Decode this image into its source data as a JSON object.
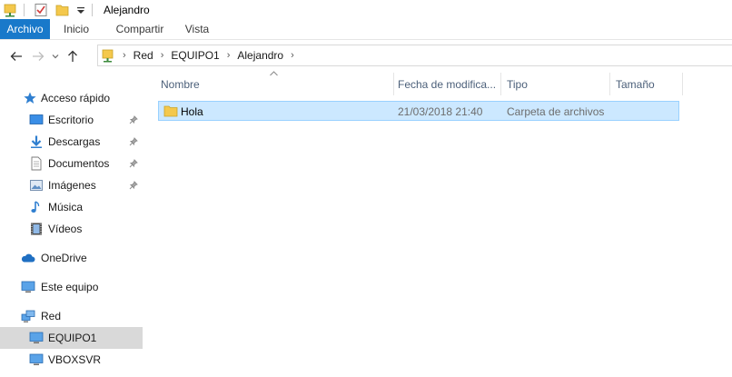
{
  "window": {
    "title": "Alejandro"
  },
  "ribbon": {
    "tabs": [
      "Archivo",
      "Inicio",
      "Compartir",
      "Vista"
    ]
  },
  "address": {
    "crumbs": [
      "Red",
      "EQUIPO1",
      "Alejandro"
    ]
  },
  "sidebar": {
    "quick_access": "Acceso rápido",
    "items": [
      {
        "label": "Escritorio",
        "icon": "desktop-icon",
        "pinned": true
      },
      {
        "label": "Descargas",
        "icon": "download-icon",
        "pinned": true
      },
      {
        "label": "Documentos",
        "icon": "document-icon",
        "pinned": true
      },
      {
        "label": "Imágenes",
        "icon": "pictures-icon",
        "pinned": true
      },
      {
        "label": "Música",
        "icon": "music-icon",
        "pinned": false
      },
      {
        "label": "Vídeos",
        "icon": "video-icon",
        "pinned": false
      }
    ],
    "onedrive": "OneDrive",
    "this_pc": "Este equipo",
    "network": "Red",
    "network_children": [
      {
        "label": "EQUIPO1",
        "selected": true
      },
      {
        "label": "VBOXSVR",
        "selected": false
      }
    ]
  },
  "columns": {
    "name": "Nombre",
    "date": "Fecha de modifica...",
    "type": "Tipo",
    "size": "Tamaño"
  },
  "files": [
    {
      "name": "Hola",
      "date": "21/03/2018 21:40",
      "type": "Carpeta de archivos",
      "size": "",
      "selected": true
    }
  ],
  "colors": {
    "file_tab": "#1979ca",
    "selection_fill": "#cce8ff",
    "selection_border": "#99d1ff",
    "nav_selected": "#d9d9d9",
    "header_text": "#4c607a",
    "folder": "#f4c84c"
  }
}
